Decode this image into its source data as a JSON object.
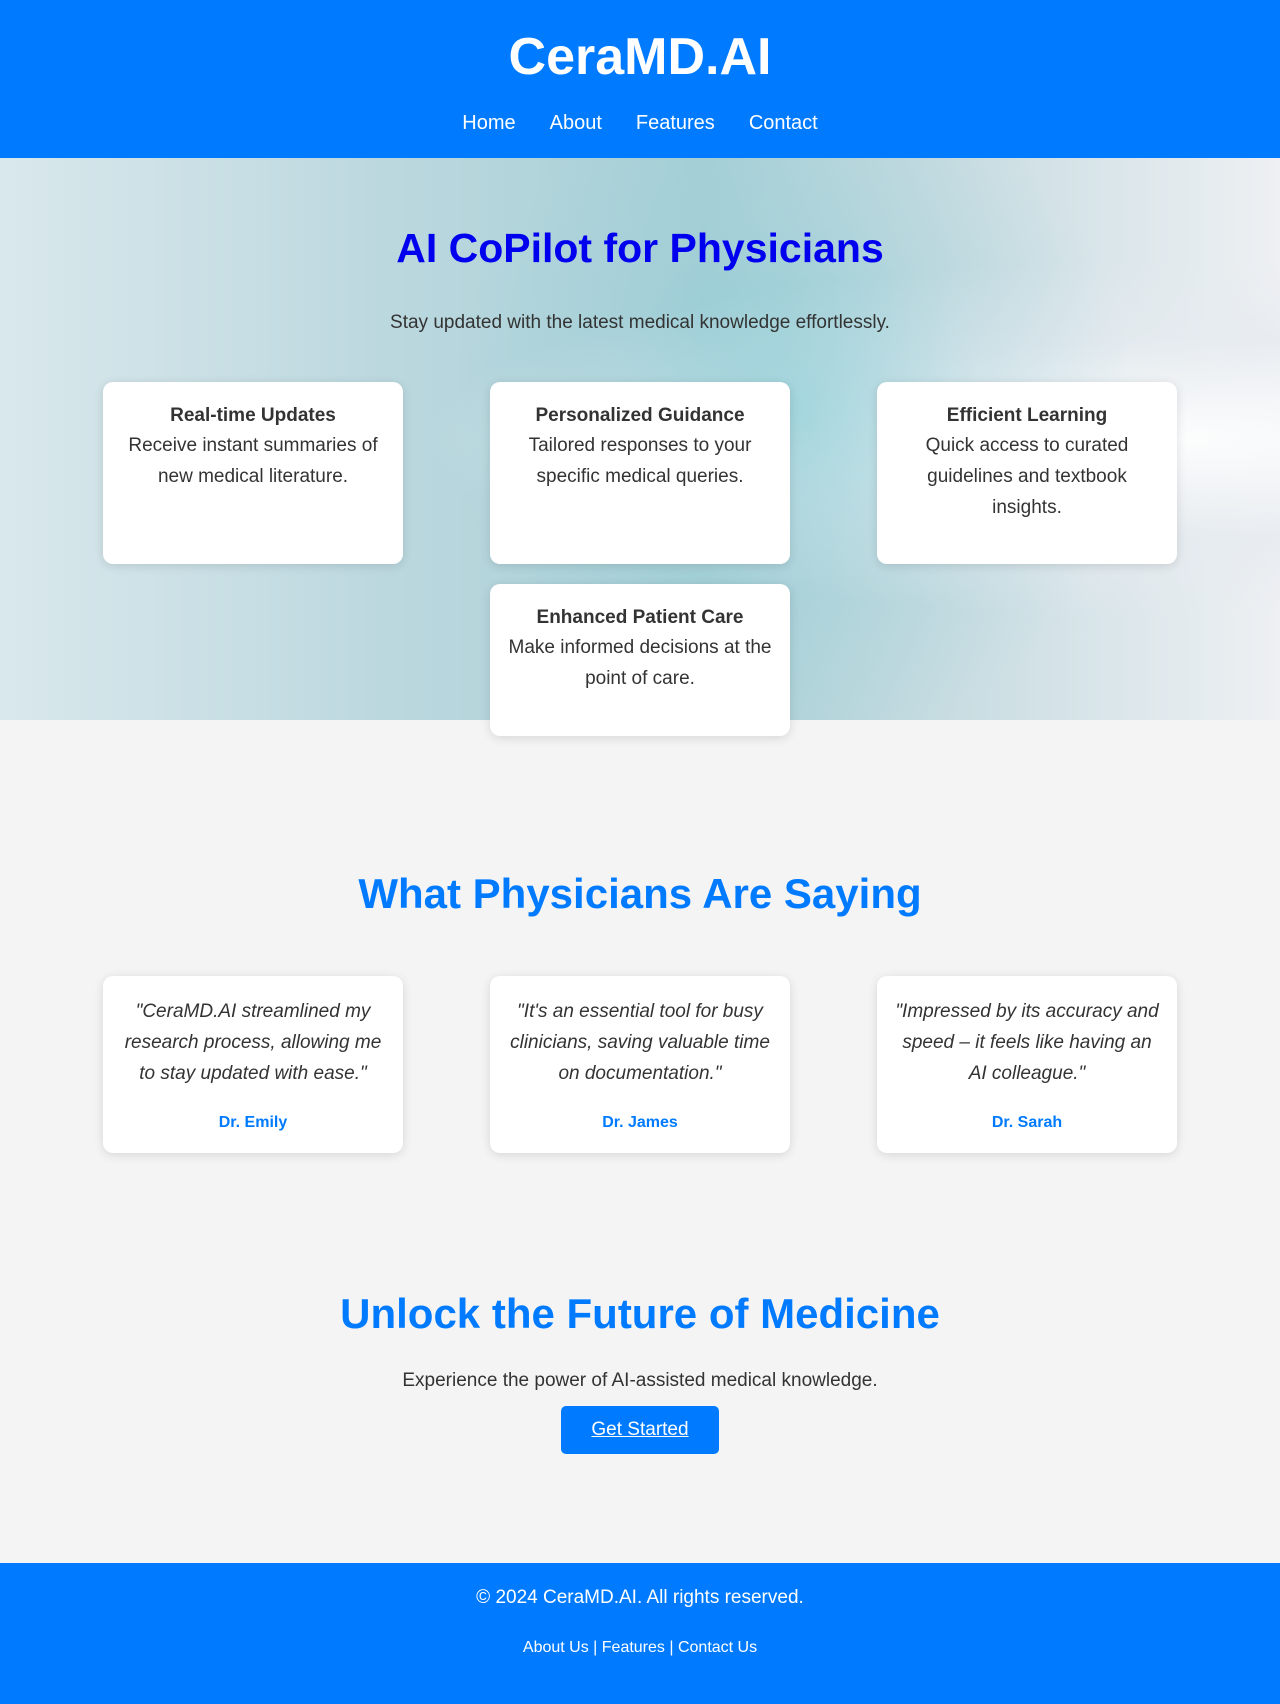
{
  "header": {
    "brand": "CeraMD.AI",
    "nav": [
      "Home",
      "About",
      "Features",
      "Contact"
    ]
  },
  "hero": {
    "title": "AI CoPilot for Physicians",
    "subtitle": "Stay updated with the latest medical knowledge effortlessly.",
    "features": [
      {
        "title": "Real-time Updates",
        "text": "Receive instant summaries of new medical literature."
      },
      {
        "title": "Personalized Guidance",
        "text": "Tailored responses to your specific medical queries."
      },
      {
        "title": "Efficient Learning",
        "text": "Quick access to curated guidelines and textbook insights."
      },
      {
        "title": "Enhanced Patient Care",
        "text": "Make informed decisions at the point of care."
      }
    ]
  },
  "testimonials": {
    "title": "What Physicians Are Saying",
    "items": [
      {
        "quote": "\"CeraMD.AI streamlined my research process, allowing me to stay updated with ease.\"",
        "author": "Dr. Emily"
      },
      {
        "quote": "\"It's an essential tool for busy clinicians, saving valuable time on documentation.\"",
        "author": "Dr. James"
      },
      {
        "quote": "\"Impressed by its accuracy and speed – it feels like having an AI colleague.\"",
        "author": "Dr. Sarah"
      }
    ]
  },
  "cta": {
    "title": "Unlock the Future of Medicine",
    "text": "Experience the power of AI-assisted medical knowledge.",
    "button": "Get Started"
  },
  "footer": {
    "copyright": "© 2024 CeraMD.AI. All rights reserved.",
    "links": [
      "About Us",
      "Features",
      "Contact Us"
    ],
    "separator": "|"
  },
  "colors": {
    "primary": "#007bff",
    "hero_title": "#0000ee",
    "background": "#f4f4f4"
  }
}
